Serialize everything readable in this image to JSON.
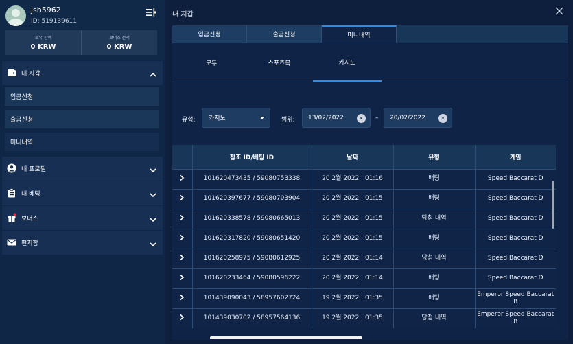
{
  "user": {
    "username": "jsh5962",
    "id_text": "ID: 519139611",
    "balances": [
      {
        "label": "보유 잔액",
        "value": "0 KRW"
      },
      {
        "label": "보너스 잔액",
        "value": "0 KRW"
      }
    ]
  },
  "sidebar": {
    "wallet": {
      "label": "내 지갑",
      "icon": "wallet-icon",
      "items": [
        "입금신청",
        "출금신청",
        "머니내역"
      ]
    },
    "sections": [
      {
        "label": "내 프로필",
        "icon": "user-icon"
      },
      {
        "label": "내 베팅",
        "icon": "clipboard-icon"
      },
      {
        "label": "보너스",
        "icon": "gift-icon"
      },
      {
        "label": "편지함",
        "icon": "envelope-icon"
      }
    ]
  },
  "main": {
    "title": "내 지갑",
    "tabs": [
      "입금신청",
      "출금신청",
      "머니내역"
    ],
    "active_tab": "머니내역",
    "subtabs": [
      "모두",
      "스포츠북",
      "카지노"
    ],
    "active_subtab": "카지노",
    "filters": {
      "type_label": "유형:",
      "type_value": "카지노",
      "range_label": "범위:",
      "date_from": "13/02/2022",
      "date_to": "20/02/2022",
      "separator": "–"
    },
    "table": {
      "columns": [
        "참조 ID/베팅 ID",
        "날짜",
        "유형",
        "게임"
      ],
      "rows": [
        {
          "ref": "101620473435 / 59080753338",
          "date": "20 2월 2022 | 01:16",
          "type": "배팅",
          "game": "Speed Baccarat D"
        },
        {
          "ref": "101620397677 / 59080703904",
          "date": "20 2월 2022 | 01:15",
          "type": "배팅",
          "game": "Speed Baccarat D"
        },
        {
          "ref": "101620338578 / 59080665013",
          "date": "20 2월 2022 | 01:15",
          "type": "당첨 내역",
          "game": "Speed Baccarat D"
        },
        {
          "ref": "101620317820 / 59080651420",
          "date": "20 2월 2022 | 01:15",
          "type": "배팅",
          "game": "Speed Baccarat D"
        },
        {
          "ref": "101620258975 / 59080612925",
          "date": "20 2월 2022 | 01:14",
          "type": "당첨 내역",
          "game": "Speed Baccarat D"
        },
        {
          "ref": "101620233464 / 59080596222",
          "date": "20 2월 2022 | 01:14",
          "type": "배팅",
          "game": "Speed Baccarat D"
        },
        {
          "ref": "101439090043 / 58957602724",
          "date": "19 2월 2022 | 01:35",
          "type": "배팅",
          "game": "Emperor Speed Baccarat B"
        },
        {
          "ref": "101439030702 / 58957564136",
          "date": "19 2월 2022 | 01:35",
          "type": "당첨 내역",
          "game": "Emperor Speed Baccarat B"
        }
      ]
    }
  },
  "colors": {
    "accent": "#2f8ee3",
    "background": "#0d1f3d",
    "sidebar": "#0f2646"
  }
}
